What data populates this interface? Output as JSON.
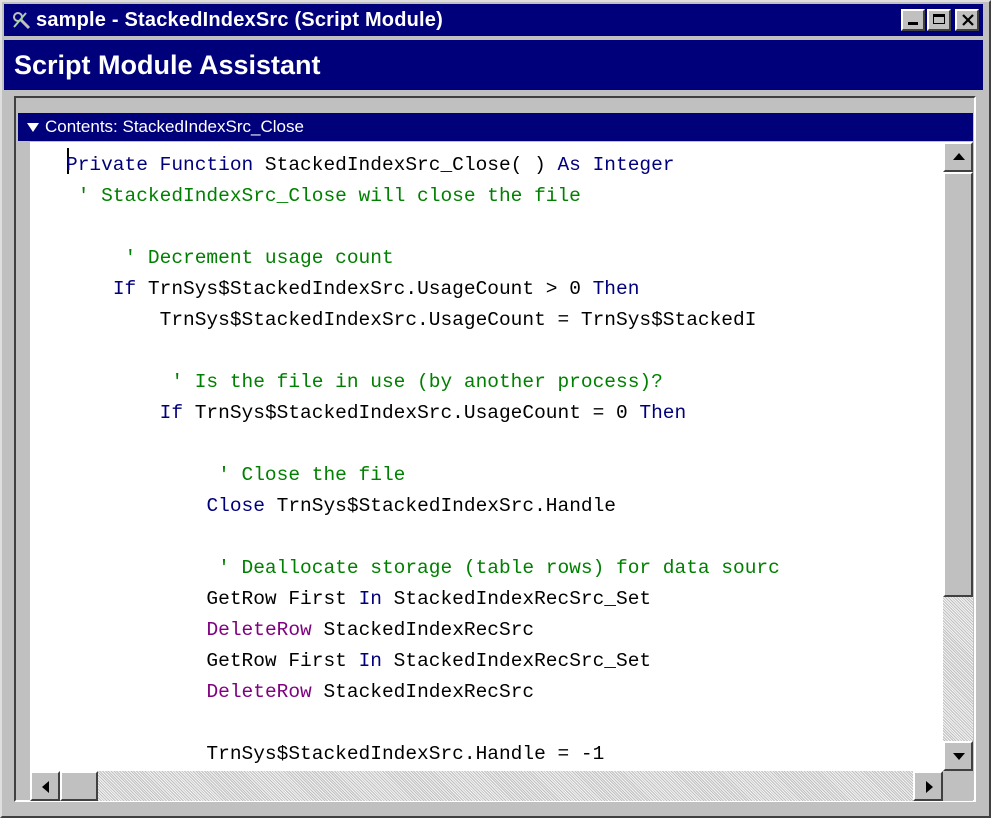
{
  "window": {
    "title": "sample - StackedIndexSrc (Script Module)"
  },
  "assistant": {
    "title": "Script Module Assistant"
  },
  "contents": {
    "label": "Contents: StackedIndexSrc_Close"
  },
  "code_lines": [
    [
      {
        "t": "Private Function",
        "c": "kw"
      },
      {
        "t": " StackedIndexSrc_Close( ) ",
        "c": ""
      },
      {
        "t": "As Integer",
        "c": "kw"
      }
    ],
    [
      {
        "t": " ' StackedIndexSrc_Close will close the file",
        "c": "cm"
      }
    ],
    [],
    [
      {
        "t": "     ' Decrement usage count",
        "c": "cm"
      }
    ],
    [
      {
        "t": "    ",
        "c": ""
      },
      {
        "t": "If",
        "c": "kw"
      },
      {
        "t": " TrnSys$StackedIndexSrc.UsageCount > 0 ",
        "c": ""
      },
      {
        "t": "Then",
        "c": "kw"
      }
    ],
    [
      {
        "t": "        TrnSys$StackedIndexSrc.UsageCount = TrnSys$StackedI",
        "c": ""
      }
    ],
    [],
    [
      {
        "t": "         ' Is the file in use (by another process)?",
        "c": "cm"
      }
    ],
    [
      {
        "t": "        ",
        "c": ""
      },
      {
        "t": "If",
        "c": "kw"
      },
      {
        "t": " TrnSys$StackedIndexSrc.UsageCount = 0 ",
        "c": ""
      },
      {
        "t": "Then",
        "c": "kw"
      }
    ],
    [],
    [
      {
        "t": "             ' Close the file",
        "c": "cm"
      }
    ],
    [
      {
        "t": "            ",
        "c": ""
      },
      {
        "t": "Close",
        "c": "kw"
      },
      {
        "t": " TrnSys$StackedIndexSrc.Handle",
        "c": ""
      }
    ],
    [],
    [
      {
        "t": "             ' Deallocate storage (table rows) for data sourc",
        "c": "cm"
      }
    ],
    [
      {
        "t": "            GetRow First ",
        "c": ""
      },
      {
        "t": "In",
        "c": "kw"
      },
      {
        "t": " StackedIndexRecSrc_Set",
        "c": ""
      }
    ],
    [
      {
        "t": "            ",
        "c": ""
      },
      {
        "t": "DeleteRow",
        "c": "pp"
      },
      {
        "t": " StackedIndexRecSrc",
        "c": ""
      }
    ],
    [
      {
        "t": "            GetRow First ",
        "c": ""
      },
      {
        "t": "In",
        "c": "kw"
      },
      {
        "t": " StackedIndexRecSrc_Set",
        "c": ""
      }
    ],
    [
      {
        "t": "            ",
        "c": ""
      },
      {
        "t": "DeleteRow",
        "c": "pp"
      },
      {
        "t": " StackedIndexRecSrc",
        "c": ""
      }
    ],
    [],
    [
      {
        "t": "            TrnSys$StackedIndexSrc.Handle = -1",
        "c": ""
      }
    ]
  ],
  "icons": {
    "app": "tools-icon",
    "minimize": "minimize-icon",
    "maximize": "maximize-icon",
    "close": "close-icon",
    "contents": "triangle-down-icon"
  },
  "colors": {
    "titlebar": "#00007b",
    "keyword": "#00007b",
    "comment": "#008000",
    "statement": "#800080",
    "face": "#c0c0c0"
  }
}
